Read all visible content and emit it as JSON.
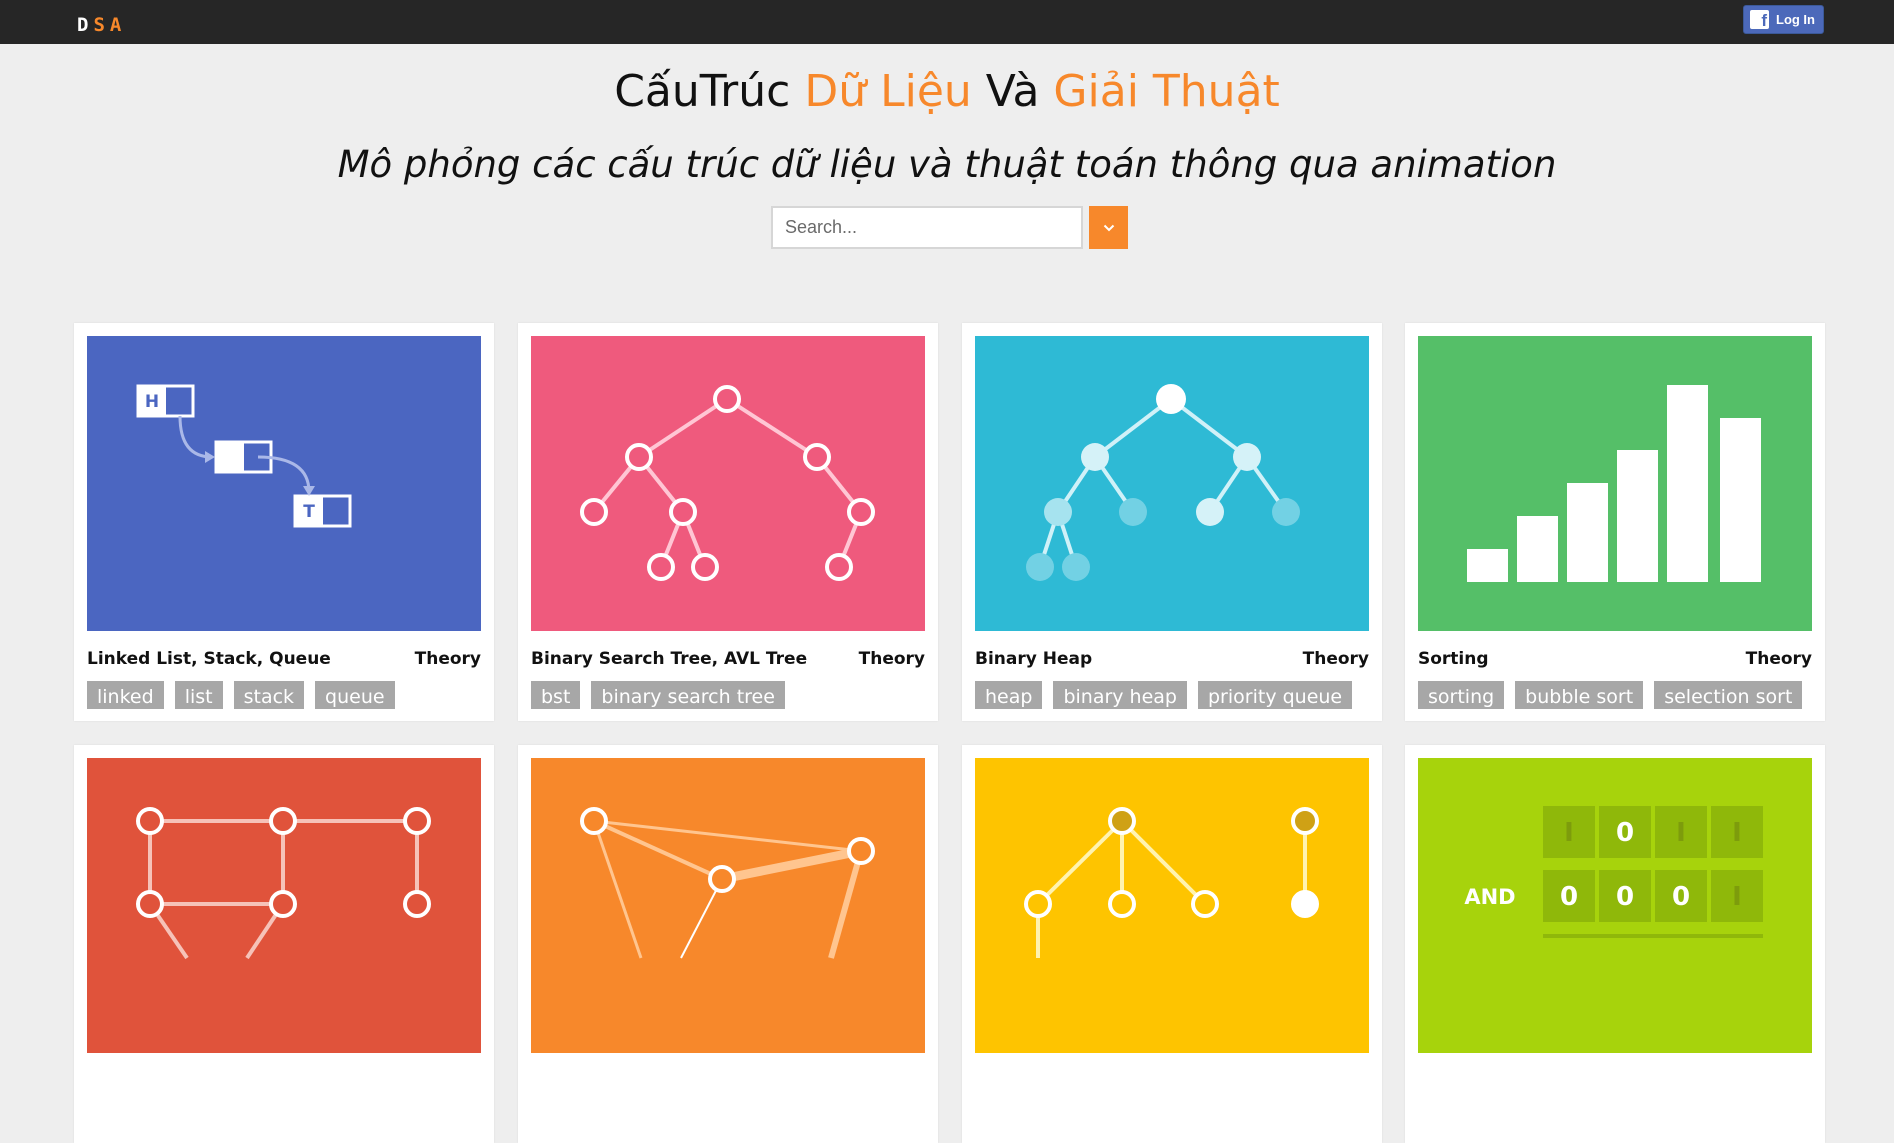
{
  "header": {
    "logo": {
      "d": "D",
      "s": "S",
      "a": "A"
    },
    "login_label": "Log In",
    "facebook_icon": "facebook-f-icon"
  },
  "hero": {
    "title_part1": "CấuTrúc ",
    "title_part2": "Dữ Liệu",
    "title_part3": " Và ",
    "title_part4": "Giải Thuật",
    "subtitle": "Mô phỏng các cấu trúc dữ liệu và thuật toán thông qua animation"
  },
  "search": {
    "placeholder": "Search...",
    "value": ""
  },
  "cards": [
    {
      "title": "Linked List, Stack, Queue",
      "link": "Theory",
      "tags": [
        "linked",
        "list",
        "stack",
        "queue"
      ],
      "color": "#4b66c1"
    },
    {
      "title": "Binary Search Tree, AVL Tree",
      "link": "Theory",
      "tags": [
        "bst",
        "binary search tree"
      ],
      "color": "#ef5a7d"
    },
    {
      "title": "Binary Heap",
      "link": "Theory",
      "tags": [
        "heap",
        "binary heap",
        "priority queue"
      ],
      "color": "#2ebad5"
    },
    {
      "title": "Sorting",
      "link": "Theory",
      "tags": [
        "sorting",
        "bubble sort",
        "selection sort"
      ],
      "color": "#55bf68"
    },
    {
      "title": "",
      "link": "",
      "tags": [],
      "color": "#e0533b"
    },
    {
      "title": "",
      "link": "",
      "tags": [],
      "color": "#f7882b"
    },
    {
      "title": "",
      "link": "",
      "tags": [],
      "color": "#fec400"
    },
    {
      "title": "",
      "link": "",
      "tags": [],
      "color": "#a7d30c"
    }
  ],
  "thumbs": {
    "linked_list": {
      "head": "H",
      "tail": "T"
    },
    "bitwise": {
      "op": "AND",
      "row1": [
        "I",
        "0",
        "I",
        "I"
      ],
      "row2": [
        "0",
        "0",
        "0",
        "I"
      ]
    }
  },
  "colors": {
    "accent": "#f7882b",
    "topbar": "#262626",
    "background": "#eeeeee",
    "tag": "#a7a7a7",
    "facebook": "#4c69ba"
  }
}
